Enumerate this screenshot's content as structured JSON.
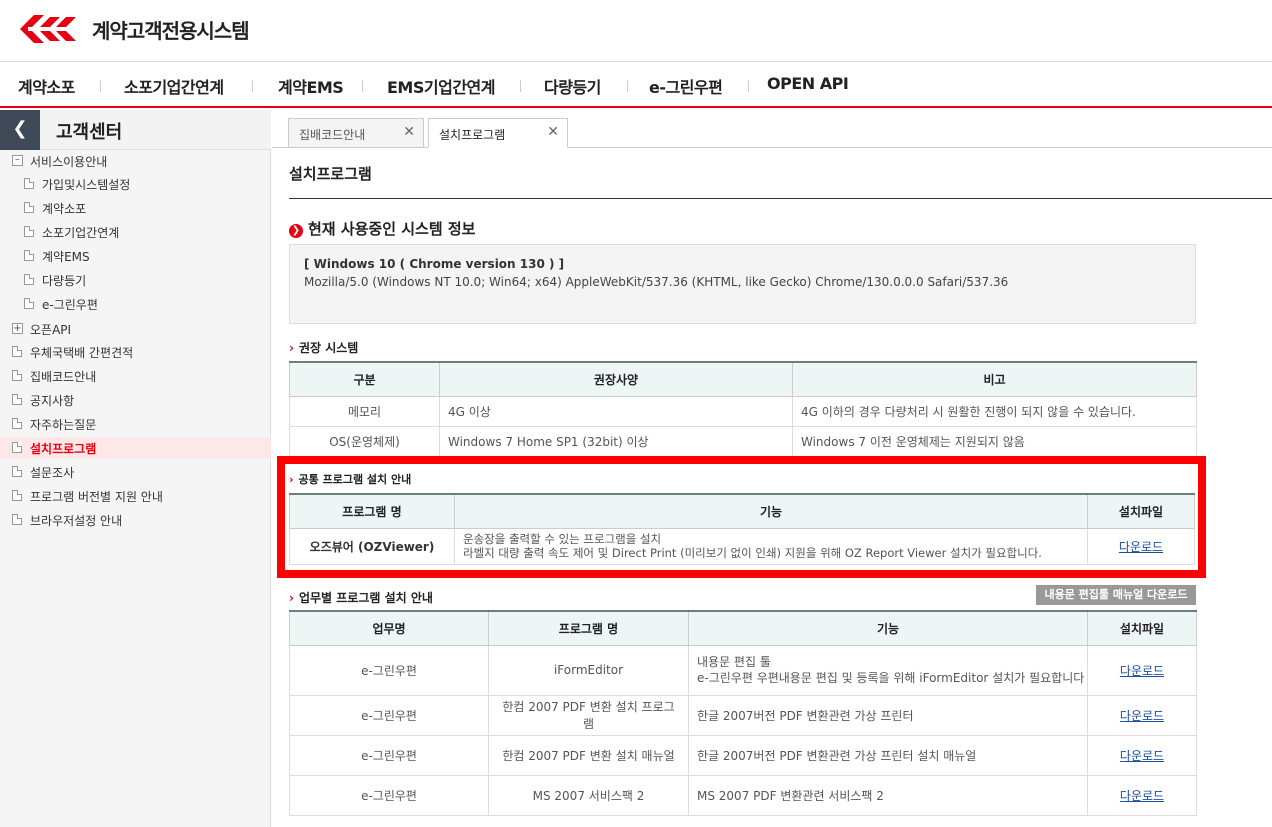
{
  "header": {
    "logo_text": "계약고객전용시스템",
    "nav": [
      "계약소포",
      "소포기업간연계",
      "계약EMS",
      "EMS기업간연계",
      "다량등기",
      "e-그린우편",
      "OPEN API"
    ]
  },
  "sidebar": {
    "back_icon": "chevron-left-icon",
    "title": "고객센터",
    "items": [
      {
        "label": "서비스이용안내",
        "icon": "minus-box-icon",
        "level": 0
      },
      {
        "label": "가입및시스템설정",
        "icon": "document-icon",
        "level": 1
      },
      {
        "label": "계약소포",
        "icon": "document-icon",
        "level": 1
      },
      {
        "label": "소포기업간연계",
        "icon": "document-icon",
        "level": 1
      },
      {
        "label": "계약EMS",
        "icon": "document-icon",
        "level": 1
      },
      {
        "label": "다량등기",
        "icon": "document-icon",
        "level": 1
      },
      {
        "label": "e-그린우편",
        "icon": "document-icon",
        "level": 1
      },
      {
        "label": "오픈API",
        "icon": "plus-box-icon",
        "level": 0
      },
      {
        "label": "우체국택배 간편견적",
        "icon": "document-icon",
        "level": 0
      },
      {
        "label": "집배코드안내",
        "icon": "document-icon",
        "level": 0
      },
      {
        "label": "공지사항",
        "icon": "document-icon",
        "level": 0
      },
      {
        "label": "자주하는질문",
        "icon": "document-icon",
        "level": 0
      },
      {
        "label": "설치프로그램",
        "icon": "document-icon",
        "level": 0,
        "active": true
      },
      {
        "label": "설문조사",
        "icon": "document-icon",
        "level": 0
      },
      {
        "label": "프로그램 버전별 지원 안내",
        "icon": "document-icon",
        "level": 0
      },
      {
        "label": "브라우저설정 안내",
        "icon": "document-icon",
        "level": 0
      }
    ]
  },
  "tabs": [
    {
      "label": "집배코드안내",
      "active": false
    },
    {
      "label": "설치프로그램",
      "active": true
    }
  ],
  "main": {
    "page_title": "설치프로그램",
    "system_info": {
      "heading": "현재 사용중인 시스템 정보",
      "line1": "[ Windows 10 ( Chrome version 130 ) ]",
      "line2": "Mozilla/5.0 (Windows NT 10.0; Win64; x64) AppleWebKit/537.36 (KHTML, like Gecko) Chrome/130.0.0.0 Safari/537.36"
    },
    "recommended": {
      "heading": "권장 시스템",
      "headers": [
        "구분",
        "권장사양",
        "비고"
      ],
      "rows": [
        [
          "메모리",
          "4G 이상",
          "4G 이하의 경우 다량처리 시 원활한 진행이 되지 않을 수 있습니다."
        ],
        [
          "OS(운영체제)",
          "Windows 7 Home SP1 (32bit) 이상",
          "Windows 7 이전 운영체제는 지원되지 않음"
        ]
      ]
    },
    "common": {
      "heading": "공통 프로그램 설치 안내",
      "headers": [
        "프로그램 명",
        "기능",
        "설치파일"
      ],
      "row": {
        "name": "오즈뷰어 (OZViewer)",
        "desc1": "운송장을 출력할 수 있는 프로그램을 설치",
        "desc2": "라벨지 대량 출력 속도 제어 및 Direct Print (미리보기 없이 인쇄) 지원을 위해 OZ Report Viewer 설치가 필요합니다.",
        "link": "다운로드"
      }
    },
    "by_task": {
      "heading": "업무별 프로그램 설치 안내",
      "manual_button": "내용문 편집툴 매뉴얼 다운로드",
      "headers": [
        "업무명",
        "프로그램 명",
        "기능",
        "설치파일"
      ],
      "rows": [
        {
          "task": "e-그린우편",
          "program": "iFormEditor",
          "desc1": "내용문 편집 툴",
          "desc2": "e-그린우편 우편내용문 편집 및 등록을 위해 iFormEditor 설치가 필요합니다",
          "link": "다운로드"
        },
        {
          "task": "e-그린우편",
          "program": "한컴 2007 PDF 변환 설치 프로그램",
          "desc1": "한글 2007버전 PDF 변환관련 가상 프린터",
          "desc2": "",
          "link": "다운로드"
        },
        {
          "task": "e-그린우편",
          "program": "한컴 2007 PDF 변환 설치 매뉴얼",
          "desc1": "한글 2007버전 PDF 변환관련 가상 프린터 설치 매뉴얼",
          "desc2": "",
          "link": "다운로드"
        },
        {
          "task": "e-그린우편",
          "program": "MS 2007 서비스팩 2",
          "desc1": "MS 2007 PDF 변환관련 서비스팩 2",
          "desc2": "",
          "link": "다운로드"
        }
      ]
    }
  }
}
